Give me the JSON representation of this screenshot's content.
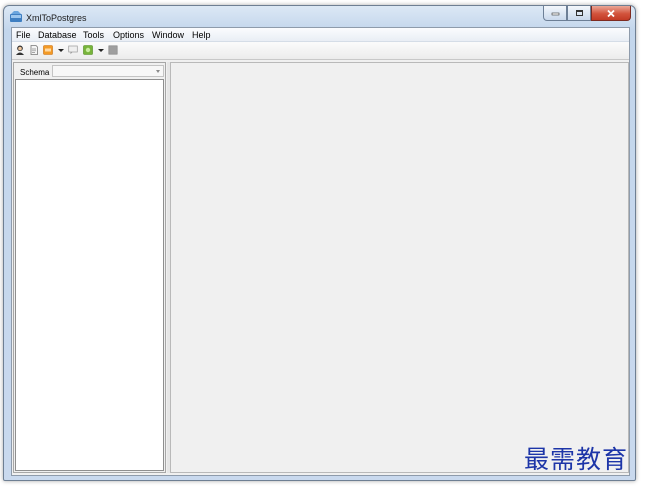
{
  "window": {
    "title": "XmlToPostgres",
    "accent_color": "#c9d9ee",
    "close_color": "#d2533c"
  },
  "menu": [
    "File",
    "Database",
    "Tools",
    "Options",
    "Window",
    "Help"
  ],
  "toolbar": {
    "icons": [
      "user-icon",
      "document-icon",
      "orange-app-icon",
      "chevron-down-icon",
      "speech-bubble-icon",
      "green-app-icon",
      "chevron-down-icon",
      "stop-icon"
    ]
  },
  "left_panel": {
    "schema_label": "Schema",
    "schema_value": ""
  },
  "watermark": "最需教育"
}
